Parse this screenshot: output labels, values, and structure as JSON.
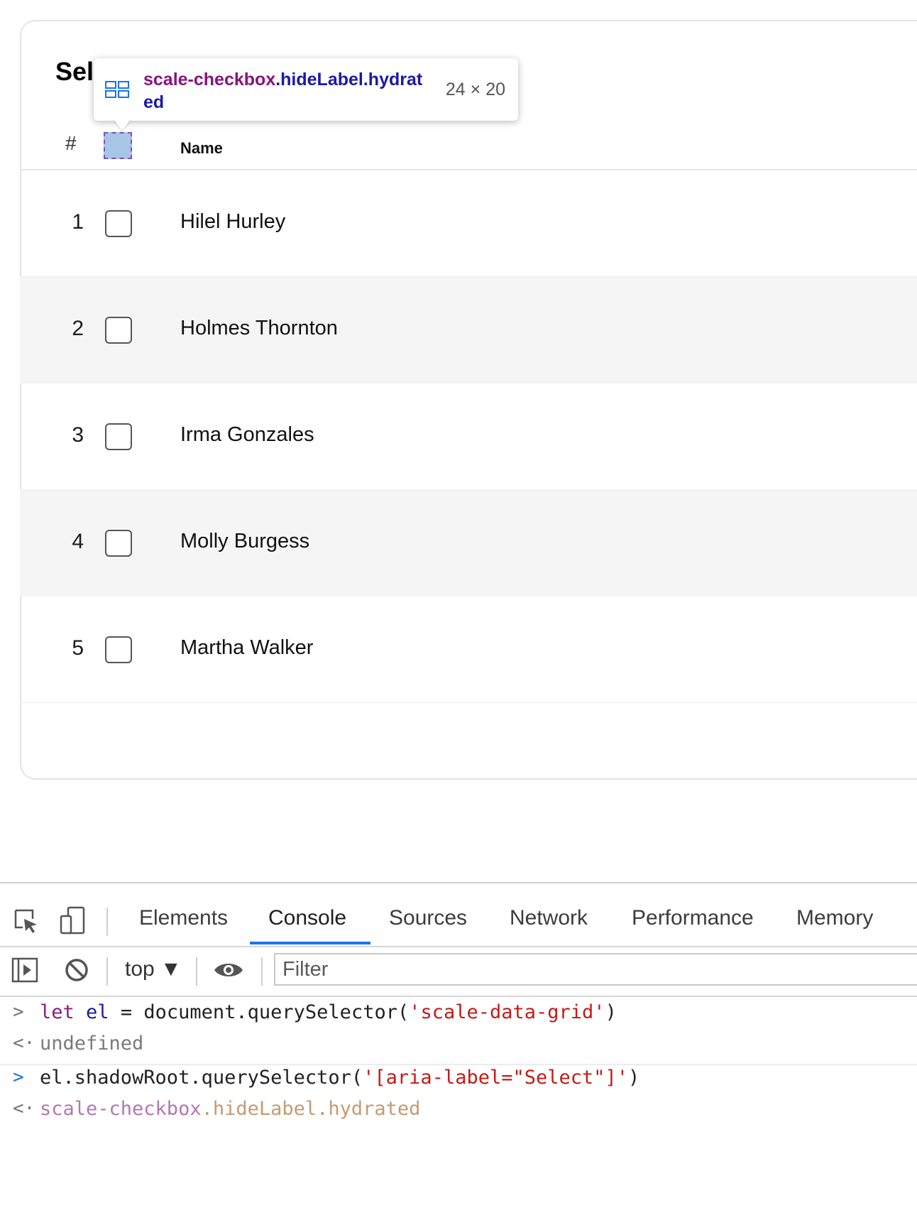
{
  "grid": {
    "title": "Sel",
    "header": {
      "hash": "#",
      "name": "Name"
    },
    "rows": [
      {
        "num": "1",
        "name": "Hilel Hurley"
      },
      {
        "num": "2",
        "name": "Holmes Thornton"
      },
      {
        "num": "3",
        "name": "Irma Gonzales"
      },
      {
        "num": "4",
        "name": "Molly Burgess"
      },
      {
        "num": "5",
        "name": "Martha Walker"
      }
    ]
  },
  "tooltip": {
    "tag": "scale-checkbox",
    "classes": ".hideLabel.hydrated",
    "size": "24 × 20"
  },
  "devtools": {
    "tabs": [
      "Elements",
      "Console",
      "Sources",
      "Network",
      "Performance",
      "Memory"
    ],
    "active_tab": "Console",
    "context": "top ▼",
    "filter_placeholder": "Filter",
    "console": {
      "line1": {
        "kw": "let",
        "var": "el",
        "eq": " = ",
        "call": "document.querySelector(",
        "arg": "'scale-data-grid'",
        "close": ")"
      },
      "line2": "undefined",
      "line3": {
        "call": "el.shadowRoot.querySelector(",
        "arg": "'[aria-label=\"Select\"]'",
        "close": ")"
      },
      "line4": {
        "tag": "scale-checkbox",
        "cls": ".hideLabel.hydrated"
      }
    },
    "colors": {
      "accent": "#1a73e8",
      "tag": "#881280",
      "string": "#c41a16"
    }
  }
}
